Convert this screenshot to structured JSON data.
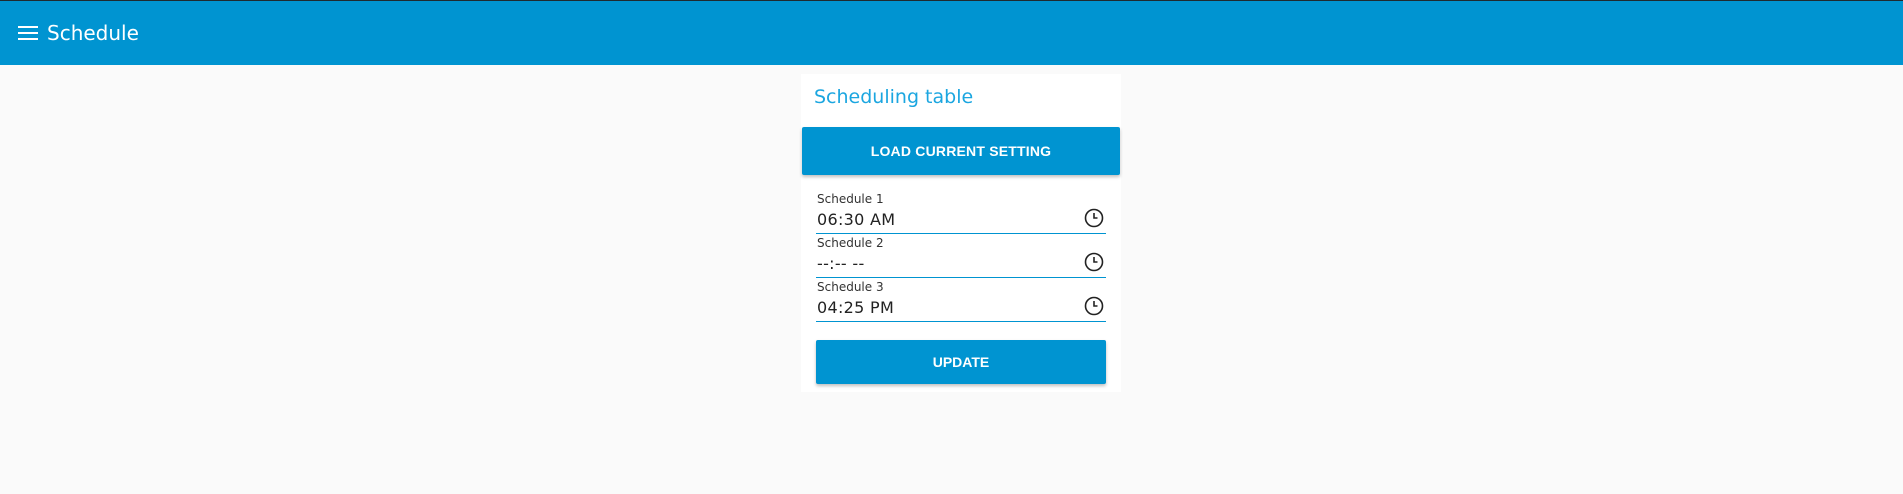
{
  "header": {
    "title": "Schedule",
    "menu_icon": "hamburger-menu-icon",
    "background_color": "#0094d1"
  },
  "card": {
    "title": "Scheduling table",
    "title_color": "#1ba6e0",
    "load_button_label": "LOAD CURRENT SETTING",
    "update_button_label": "UPDATE",
    "fields": [
      {
        "label": "Schedule 1",
        "value": "06:30  AM",
        "icon": "clock-icon"
      },
      {
        "label": "Schedule 2",
        "value": "--:--  --",
        "icon": "clock-icon"
      },
      {
        "label": "Schedule 3",
        "value": "04:25  PM",
        "icon": "clock-icon"
      }
    ]
  }
}
